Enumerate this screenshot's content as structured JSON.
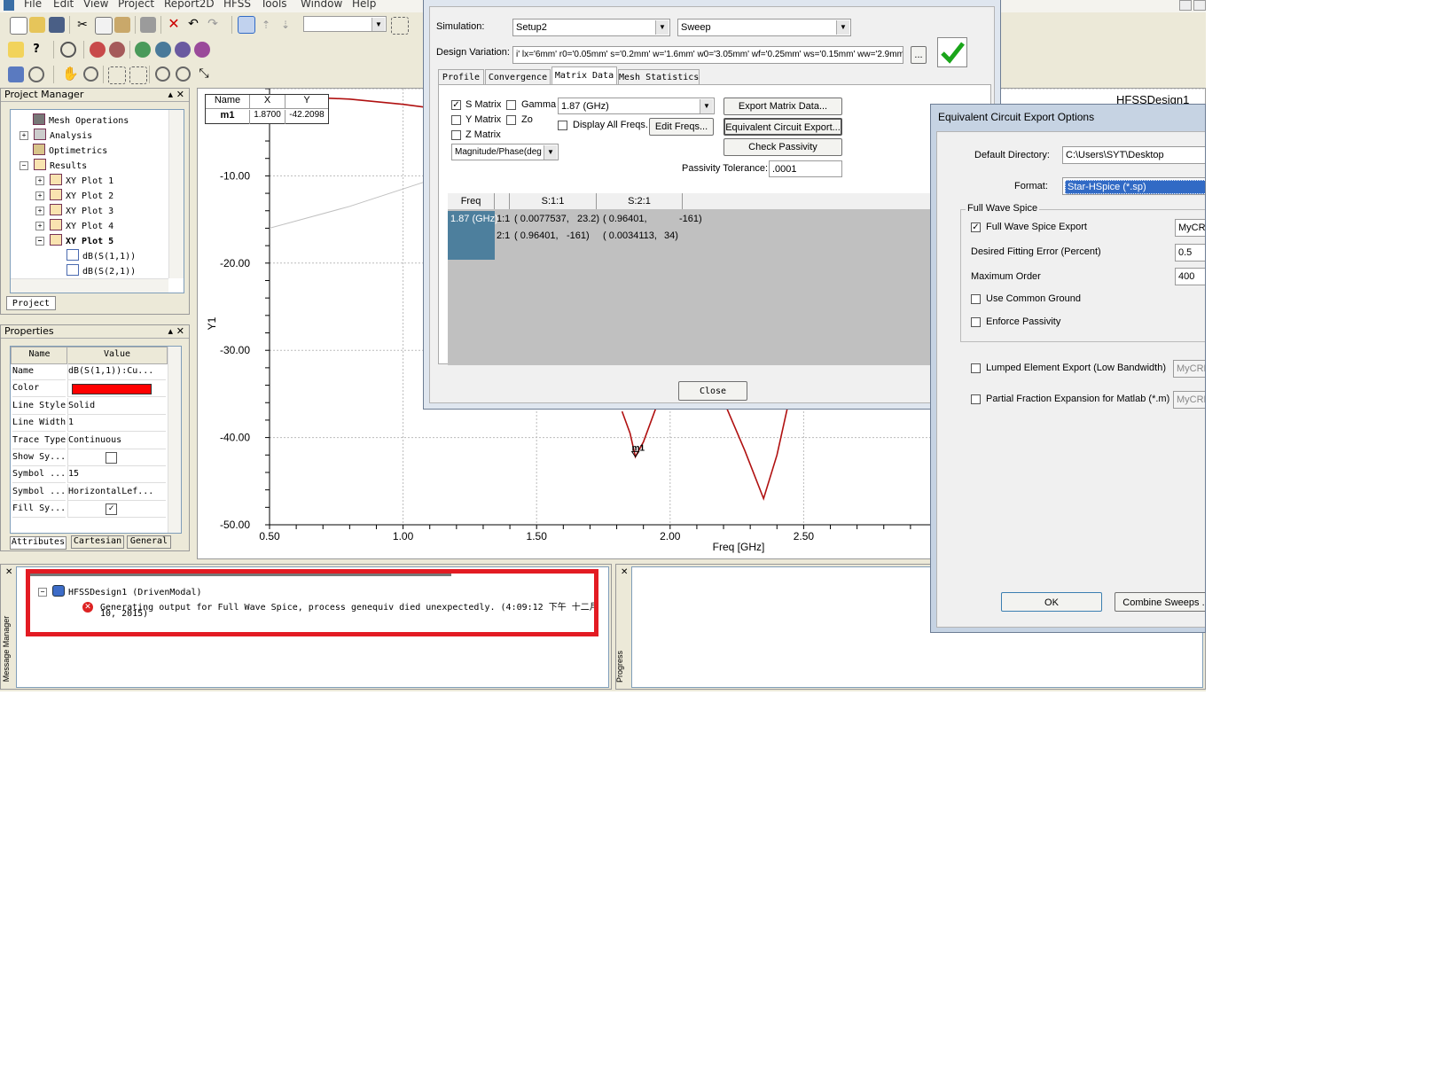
{
  "menu": [
    "File",
    "Edit",
    "View",
    "Project",
    "Report2D",
    "HFSS",
    "Tools",
    "Window",
    "Help"
  ],
  "project_manager": {
    "title": "Project Manager",
    "tab": "Project",
    "items": [
      "Mesh Operations",
      "Analysis",
      "Optimetrics",
      "Results",
      "XY Plot 1",
      "XY Plot 2",
      "XY Plot 3",
      "XY Plot 4",
      "XY Plot 5",
      "dB(S(1,1))",
      "dB(S(2,1))"
    ]
  },
  "properties": {
    "title": "Properties",
    "headers": [
      "Name",
      "Value"
    ],
    "rows": [
      {
        "name": "Name",
        "value": "dB(S(1,1)):Cu..."
      },
      {
        "name": "Color",
        "value": ""
      },
      {
        "name": "Line Style",
        "value": "Solid"
      },
      {
        "name": "Line Width",
        "value": "1"
      },
      {
        "name": "Trace Type",
        "value": "Continuous"
      },
      {
        "name": "Show Sy...",
        "value": ""
      },
      {
        "name": "Symbol ...",
        "value": "15"
      },
      {
        "name": "Symbol ...",
        "value": "HorizontalLef..."
      },
      {
        "name": "Fill Sy...",
        "value": ""
      }
    ],
    "tabs": [
      "Attributes",
      "Cartesian",
      "General"
    ],
    "color": "#ff0000"
  },
  "chart_data": {
    "type": "line",
    "xlabel": "Freq [GHz]",
    "ylabel": "Y1",
    "xlim": [
      0.5,
      3.0
    ],
    "ylim": [
      -50.0,
      0.0
    ],
    "x_ticks": [
      "0.50",
      "1.00",
      "1.50",
      "2.00",
      "2.50"
    ],
    "y_ticks": [
      "-10.00",
      "-20.00",
      "-30.00",
      "-40.00",
      "-50.00"
    ],
    "series": [
      {
        "color": "#b01010",
        "x": [
          0.5,
          0.8,
          1.0,
          1.2,
          1.4,
          1.55
        ],
        "y": [
          -0.8,
          -1.2,
          -1.8,
          -2.6,
          -4.0,
          -5.8
        ]
      },
      {
        "color": "#b01010",
        "x": [
          1.82,
          1.85,
          1.87,
          1.9,
          1.96
        ],
        "y": [
          -37.0,
          -39.5,
          -42.2,
          -40.5,
          -35.5
        ]
      },
      {
        "color": "#b01010",
        "x": [
          2.21,
          2.28,
          2.35,
          2.4,
          2.44
        ],
        "y": [
          -36.5,
          -41.5,
          -47.0,
          -42.0,
          -36.5
        ]
      },
      {
        "color": "#c0c0c0",
        "x": [
          0.5,
          0.8,
          1.1,
          1.3
        ],
        "y": [
          -16.0,
          -13.5,
          -10.5,
          -8.0
        ]
      }
    ],
    "marker": {
      "name": "m1",
      "x": 1.87,
      "y": -42.2098
    }
  },
  "marker_table": {
    "headers": [
      "Name",
      "X",
      "Y"
    ],
    "row": [
      "m1",
      "1.8700",
      "-42.2098"
    ]
  },
  "solutions_dialog": {
    "simulation_label": "Simulation:",
    "simulation_value": "Setup2",
    "sweep_value": "Sweep",
    "design_variation_label": "Design Variation:",
    "design_variation_value": "i' lx='6mm' r0='0.05mm' s='0.2mm' w='1.6mm' w0='3.05mm' wf='0.25mm' ws='0.15mm' ww='2.9mm'",
    "browse": "...",
    "tabs": [
      "Profile",
      "Convergence",
      "Matrix Data",
      "Mesh Statistics"
    ],
    "s_matrix": "S Matrix",
    "y_matrix": "Y Matrix",
    "z_matrix": "Z Matrix",
    "gamma": "Gamma",
    "zo": "Zo",
    "freq_select": "1.87 (GHz)",
    "display_all_freqs": "Display All Freqs.",
    "edit_freqs": "Edit Freqs...",
    "export_matrix": "Export Matrix Data...",
    "equiv_circuit": "Equivalent Circuit Export...",
    "check_passivity": "Check Passivity",
    "passivity_label": "Passivity Tolerance:",
    "passivity_value": ".0001",
    "format_select": "Magnitude/Phase(deg",
    "grid_headers": [
      "Freq",
      "S:1:1",
      "S:2:1"
    ],
    "grid_freq": "1.87 (GHz)",
    "grid_rows": [
      [
        "1:1",
        "( 0.0077537,",
        "23.2)",
        "( 0.96401,",
        "-161)"
      ],
      [
        "2:1",
        "( 0.96401,",
        "-161)",
        "( 0.0034113,",
        "34)"
      ]
    ],
    "close": "Close"
  },
  "export_dialog": {
    "title": "Equivalent Circuit Export Options",
    "default_dir_label": "Default Directory:",
    "default_dir_value": "C:\\Users\\SYT\\Desktop",
    "format_label": "Format:",
    "format_value": "Star-HSpice (*.sp)",
    "group_label": "Full Wave Spice",
    "full_wave_export": "Full Wave Spice Export",
    "full_wave_name": "MyCRL",
    "fitting_error_label": "Desired Fitting Error (Percent)",
    "fitting_error_value": "0.5",
    "max_order_label": "Maximum Order",
    "max_order_value": "400",
    "common_ground": "Use Common Ground",
    "enforce_passivity": "Enforce Passivity",
    "lumped_label": "Lumped Element Export (Low Bandwidth)",
    "lumped_name": "MyCRL",
    "partial_label": "Partial Fraction Expansion for Matlab (*.m)",
    "partial_name": "MyCRL",
    "ok": "OK",
    "combine": "Combine Sweeps ..",
    "right_title": "HFSSDesign1"
  },
  "message_manager": {
    "side_label": "Message Manager",
    "design": "HFSSDesign1 (DrivenModal)",
    "error_line1": "Generating output for Full Wave Spice, process genequiv died unexpectedly. (4:09:12 下午  十二月",
    "error_line2": "10, 2015)",
    "highlight_color": "#e31b23"
  },
  "progress": {
    "side_label": "Progress"
  }
}
